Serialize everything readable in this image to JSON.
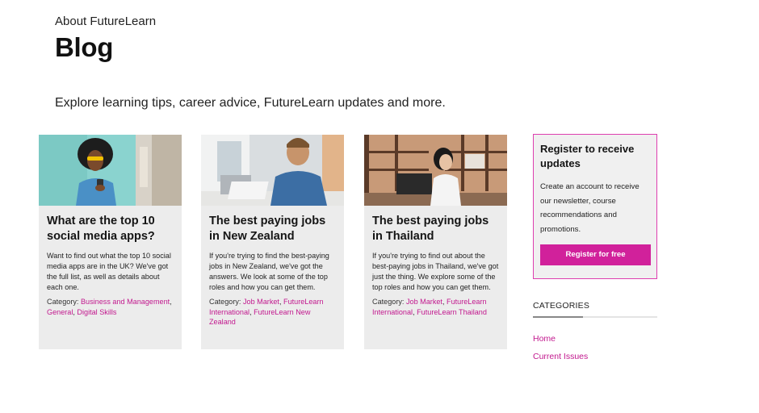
{
  "header": {
    "eyebrow": "About FutureLearn",
    "title": "Blog",
    "intro": "Explore learning tips, career advice, FutureLearn updates and more."
  },
  "posts": [
    {
      "title": "What are the top 10 social media apps?",
      "excerpt": "Want to find out what the top 10 social media apps are in the UK? We've got the full list, as well as details about each one.",
      "category_label": "Category:",
      "categories": [
        "Business and Management",
        "General",
        "Digital Skills"
      ]
    },
    {
      "title": "The best paying jobs in New Zealand",
      "excerpt": "If you're trying to find the best-paying jobs in New Zealand, we've got the answers. We look at some of the top roles and how you can get them.",
      "category_label": "Category:",
      "categories": [
        "Job Market",
        "FutureLearn International",
        "FutureLearn New Zealand"
      ]
    },
    {
      "title": "The best paying jobs in Thailand",
      "excerpt": "If you're trying to find out about the best-paying jobs in Thailand, we've got just the thing. We explore some of the top roles and how you can get them.",
      "category_label": "Category:",
      "categories": [
        "Job Market",
        "FutureLearn International",
        "FutureLearn Thailand"
      ]
    }
  ],
  "register": {
    "title": "Register to receive updates",
    "body": "Create an account to receive our newsletter, course recommendations and promotions.",
    "button": "Register for free"
  },
  "sidebar": {
    "heading": "CATEGORIES",
    "links": [
      "Home",
      "Current Issues"
    ]
  },
  "colors": {
    "accent": "#c2188e",
    "button": "#d1219b",
    "card_bg": "#ececec"
  }
}
